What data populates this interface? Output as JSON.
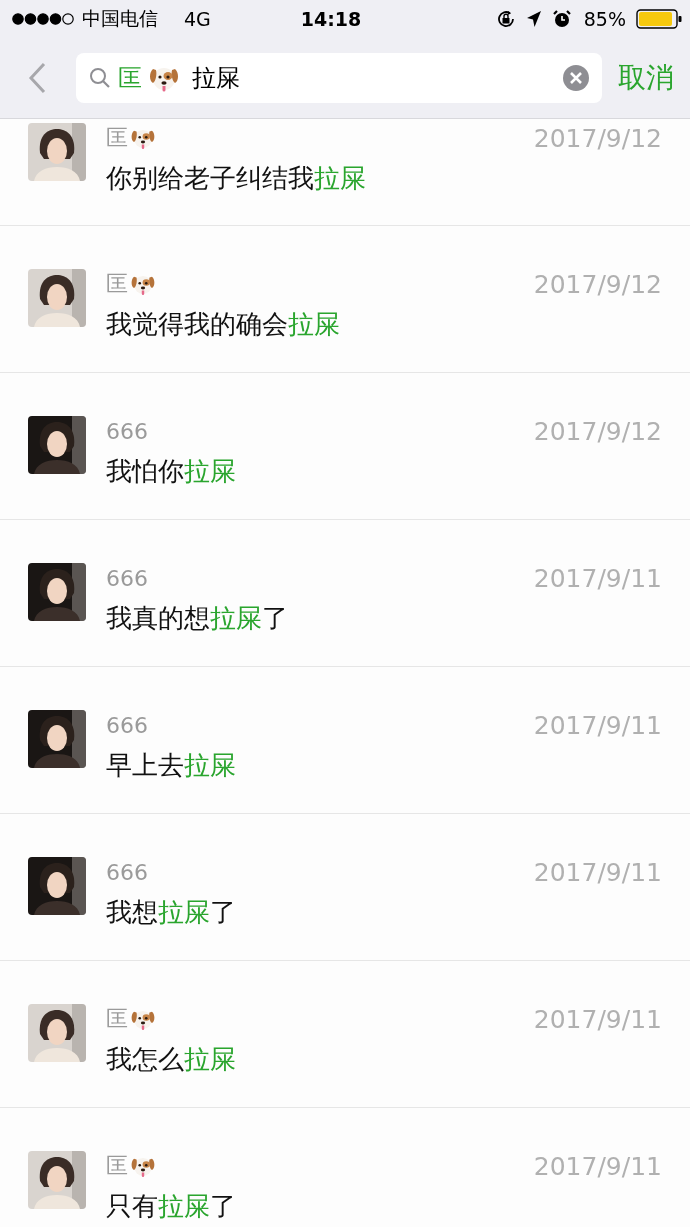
{
  "status_bar": {
    "carrier": "中国电信",
    "network": "4G",
    "time": "14:18",
    "battery": "85%"
  },
  "search": {
    "contact": "匡",
    "contact_dog_emoji": true,
    "keyword": "拉屎",
    "cancel": "取消"
  },
  "results": [
    {
      "sender": "匡",
      "dog_emoji": true,
      "kind": "light",
      "date": "2017/9/12",
      "message": [
        {
          "text": "你别给老子纠结我",
          "highlight": false
        },
        {
          "text": "拉屎",
          "highlight": true
        }
      ]
    },
    {
      "sender": "匡",
      "dog_emoji": true,
      "kind": "light",
      "date": "2017/9/12",
      "message": [
        {
          "text": "我觉得我的确会",
          "highlight": false
        },
        {
          "text": "拉屎",
          "highlight": true
        }
      ]
    },
    {
      "sender": "666",
      "dog_emoji": false,
      "kind": "dark",
      "date": "2017/9/12",
      "message": [
        {
          "text": "我怕你",
          "highlight": false
        },
        {
          "text": "拉屎",
          "highlight": true
        }
      ]
    },
    {
      "sender": "666",
      "dog_emoji": false,
      "kind": "dark",
      "date": "2017/9/11",
      "message": [
        {
          "text": "我真的想",
          "highlight": false
        },
        {
          "text": "拉屎",
          "highlight": true
        },
        {
          "text": "了",
          "highlight": false
        }
      ]
    },
    {
      "sender": "666",
      "dog_emoji": false,
      "kind": "dark",
      "date": "2017/9/11",
      "message": [
        {
          "text": "早上去",
          "highlight": false
        },
        {
          "text": "拉屎",
          "highlight": true
        }
      ]
    },
    {
      "sender": "666",
      "dog_emoji": false,
      "kind": "dark",
      "date": "2017/9/11",
      "message": [
        {
          "text": "我想",
          "highlight": false
        },
        {
          "text": "拉屎",
          "highlight": true
        },
        {
          "text": "了",
          "highlight": false
        }
      ]
    },
    {
      "sender": "匡",
      "dog_emoji": true,
      "kind": "light",
      "date": "2017/9/11",
      "message": [
        {
          "text": "我怎么",
          "highlight": false
        },
        {
          "text": "拉屎",
          "highlight": true
        }
      ]
    },
    {
      "sender": "匡",
      "dog_emoji": true,
      "kind": "light",
      "date": "2017/9/11",
      "message": [
        {
          "text": "只有",
          "highlight": false
        },
        {
          "text": "拉屎",
          "highlight": true
        },
        {
          "text": "了",
          "highlight": false
        }
      ]
    }
  ]
}
